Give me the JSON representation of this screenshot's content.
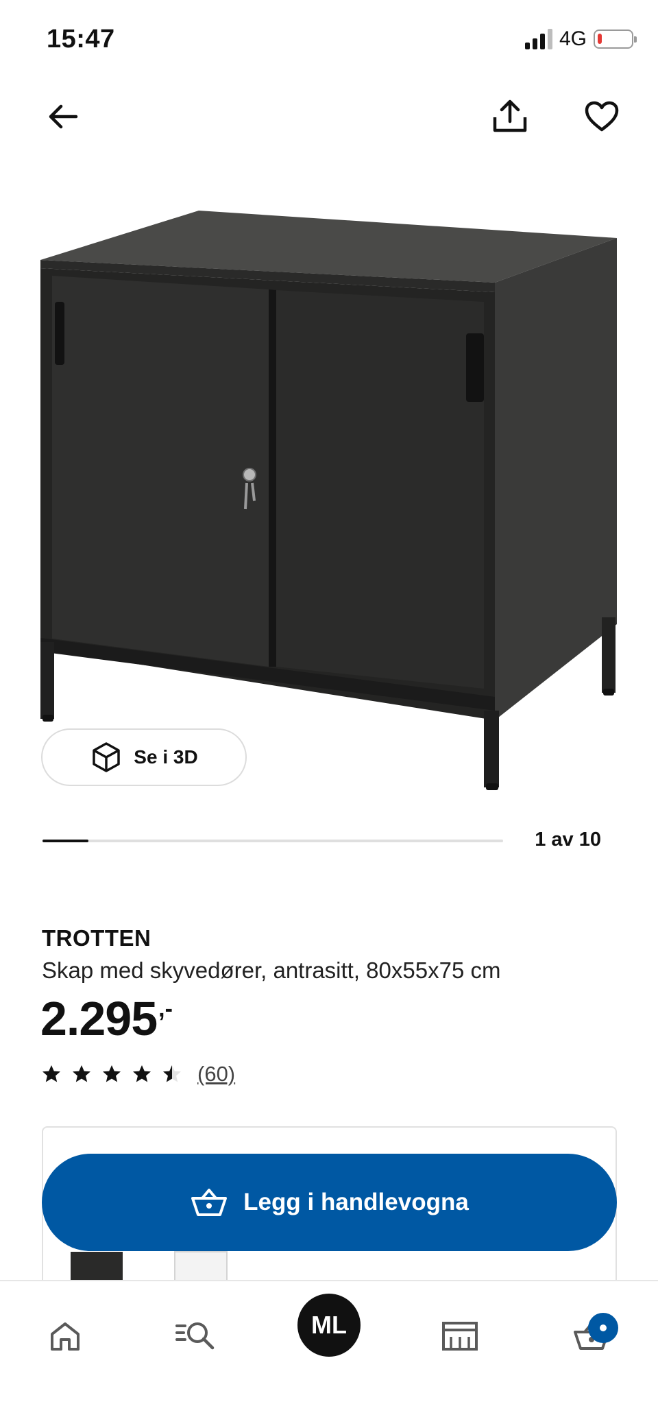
{
  "status_bar": {
    "time": "15:47",
    "network": "4G",
    "battery_level": 0.12,
    "battery_color": "#e53935"
  },
  "top_bar": {
    "icons": [
      "back-arrow-icon",
      "share-icon",
      "heart-icon"
    ]
  },
  "gallery": {
    "view_3d_label": "Se i 3D",
    "counter": "1 av 10",
    "current": 1,
    "total": 10
  },
  "product": {
    "name": "TROTTEN",
    "description": "Skap med skyvedører, antrasitt, 80x55x75 cm",
    "price": "2.295",
    "price_suffix": ",-",
    "rating": 4.5,
    "rating_max": 5,
    "review_count": "(60)"
  },
  "cta": {
    "add_to_cart_label": "Legg i handlevogna"
  },
  "bottom_nav": {
    "items": [
      "home-icon",
      "search-icon",
      "profile",
      "stores-icon",
      "cart-icon"
    ],
    "profile_initials": "ML"
  },
  "colors": {
    "primary_blue": "#0058a3",
    "text": "#111111"
  }
}
